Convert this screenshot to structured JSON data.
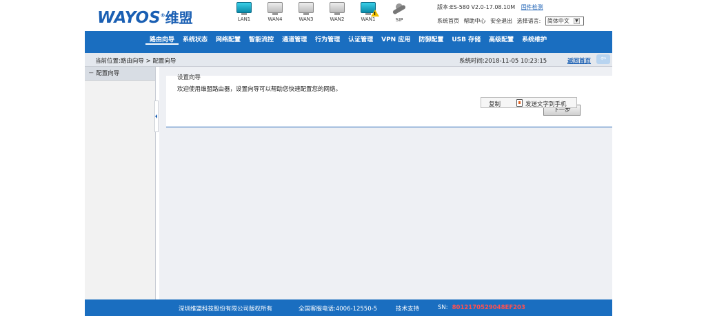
{
  "brand": {
    "logo_text": "WAYOS",
    "logo_reg": "®",
    "logo_cn": "维盟"
  },
  "ports": [
    {
      "label": "LAN1",
      "state": "on",
      "icon": "monitor-icon"
    },
    {
      "label": "WAN4",
      "state": "off",
      "icon": "monitor-icon"
    },
    {
      "label": "WAN3",
      "state": "off",
      "icon": "monitor-icon"
    },
    {
      "label": "WAN2",
      "state": "off",
      "icon": "monitor-icon"
    },
    {
      "label": "WAN1",
      "state": "warn",
      "icon": "monitor-icon"
    },
    {
      "label": "SIP",
      "state": "off",
      "icon": "phone-handset-icon"
    }
  ],
  "header": {
    "version": "版本:ES-580 V2.0-17.08.10M",
    "check_update": "固件检测",
    "link_home": "系统首页",
    "link_help": "帮助中心",
    "link_security": "安全退出",
    "lang_label": "选择语言:",
    "lang_value": "简体中文"
  },
  "nav": {
    "items": [
      {
        "label": "路由向导",
        "active": true
      },
      {
        "label": "系统状态",
        "active": false
      },
      {
        "label": "网络配置",
        "active": false
      },
      {
        "label": "智能流控",
        "active": false
      },
      {
        "label": "通道管理",
        "active": false
      },
      {
        "label": "行为管理",
        "active": false
      },
      {
        "label": "认证管理",
        "active": false
      },
      {
        "label": "VPN 应用",
        "active": false
      },
      {
        "label": "防御配置",
        "active": false
      },
      {
        "label": "USB 存储",
        "active": false
      },
      {
        "label": "高级配置",
        "active": false
      },
      {
        "label": "系统维护",
        "active": false
      }
    ]
  },
  "crumb": {
    "text": "当前位置:路由向导 > 配置向导",
    "system_time": "系统时间:2018-11-05 10:23:15",
    "back_label": "返回首页"
  },
  "sidebar": {
    "items": [
      {
        "label": "配置向导"
      }
    ]
  },
  "main": {
    "panel_title": "设置向导",
    "panel_desc": "欢迎使用维盟路由器，设置向导可以帮助您快速配置您的网络。",
    "next_button": "下一步",
    "popup_copy": "复制",
    "popup_send": "发送文字到手机"
  },
  "footer": {
    "copyright": "深圳维盟科技股份有限公司版权所有",
    "hotline": "全国客服电话:4006-12550-5",
    "support": "技术支持",
    "sn_label": "SN:",
    "sn_value": "8012170529048EF203"
  },
  "colors": {
    "nav_bg": "#1a6ec0",
    "brand": "#1a5fb3",
    "sn": "#ff5050"
  }
}
